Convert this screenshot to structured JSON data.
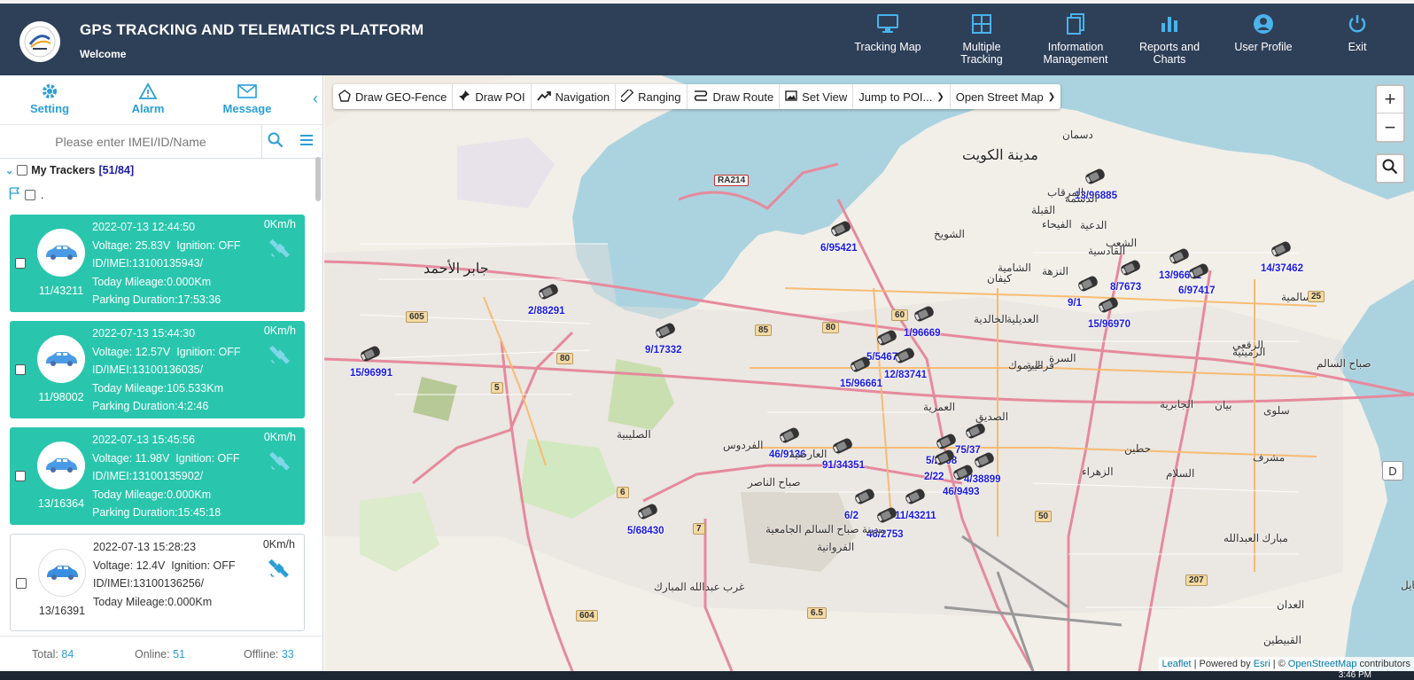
{
  "header": {
    "title": "GPS TRACKING AND TELEMATICS PLATFORM",
    "welcome": "Welcome",
    "nav": [
      {
        "label": "Tracking Map",
        "icon": "monitor-icon"
      },
      {
        "label": "Multiple\nTracking",
        "icon": "grid-icon"
      },
      {
        "label": "Information\nManagement",
        "icon": "documents-icon"
      },
      {
        "label": "Reports and\nCharts",
        "icon": "bar-chart-icon"
      },
      {
        "label": "User Profile",
        "icon": "user-icon"
      },
      {
        "label": "Exit",
        "icon": "power-icon"
      }
    ]
  },
  "sidebar": {
    "tabs": [
      {
        "label": "Setting",
        "icon": "gear-icon"
      },
      {
        "label": "Alarm",
        "icon": "warning-icon"
      },
      {
        "label": "Message",
        "icon": "envelope-icon"
      }
    ],
    "search_placeholder": "Please enter IMEI/ID/Name",
    "tree_label": "My Trackers",
    "tree_count": "[51/84]",
    "flag_label": ".",
    "trackers": [
      {
        "name": "11/43211",
        "time": "2022-07-13 12:44:50",
        "speed": "0Km/h",
        "voltage": "Voltage: 25.83V",
        "ignition": "Ignition: OFF",
        "imei": "ID/IMEI:13100135943/",
        "mileage": "Today Mileage:0.000Km",
        "parking": "Parking Duration:17:53:36",
        "status": "online"
      },
      {
        "name": "11/98002",
        "time": "2022-07-13 15:44:30",
        "speed": "0Km/h",
        "voltage": "Voltage: 12.57V",
        "ignition": "Ignition: OFF",
        "imei": "ID/IMEI:13100136035/",
        "mileage": "Today Mileage:105.533Km",
        "parking": "Parking Duration:4:2:46",
        "status": "online"
      },
      {
        "name": "13/16364",
        "time": "2022-07-13 15:45:56",
        "speed": "0Km/h",
        "voltage": "Voltage: 11.98V",
        "ignition": "Ignition: OFF",
        "imei": "ID/IMEI:13100135902/",
        "mileage": "Today Mileage:0.000Km",
        "parking": "Parking Duration:15:45:18",
        "status": "online"
      },
      {
        "name": "13/16391",
        "time": "2022-07-13 15:28:23",
        "speed": "0Km/h",
        "voltage": "Voltage: 12.4V",
        "ignition": "Ignition: OFF",
        "imei": "ID/IMEI:13100136256/",
        "mileage": "Today Mileage:0.000Km",
        "parking": "",
        "status": "offline"
      }
    ],
    "footer": {
      "total_label": "Total:",
      "total": "84",
      "online_label": "Online:",
      "online": "51",
      "offline_label": "Offline:",
      "offline": "33"
    }
  },
  "map": {
    "toolbar": [
      "Draw GEO-Fence",
      "Draw POI",
      "Navigation",
      "Ranging",
      "Draw Route",
      "Set View",
      "Jump to POI...",
      "Open Street Map"
    ],
    "zoom_in": "+",
    "zoom_out": "−",
    "d_button": "D",
    "attribution": {
      "leaflet": "Leaflet",
      "powered": "| Powered by",
      "esri": "Esri",
      "sep": "| ©",
      "osm": "OpenStreetMap",
      "contributors": "contributors"
    },
    "vehicles": [
      "13/96885",
      "6/95421",
      "2/88291",
      "9/17332",
      "15/96991",
      "13/96631",
      "8/7673",
      "6/97417",
      "14/37462",
      "9/1",
      "15/96970",
      "1/96669",
      "5/5467",
      "12/83741",
      "15/96661",
      "46/9136",
      "91/34351",
      "5/2098",
      "2/22",
      "75/37",
      "4/38899",
      "46/9493",
      "6/2",
      "11/43211",
      "46/2753",
      "5/68430"
    ],
    "places": [
      "مدينة الكويت",
      "جابر الأحمد",
      "الفروانية",
      "العارضية",
      "الصليبية",
      "الفردوس",
      "صباح الناصر",
      "العمرية",
      "السالمية",
      "الجابرية",
      "بيان",
      "سلوى",
      "مشرف",
      "حطين",
      "الزهراء",
      "الصديق",
      "السلام",
      "مبارك العبدالله",
      "صباح السالم",
      "المسايل",
      "العدان",
      "الشويخ",
      "الدسمة",
      "الشعب",
      "الدعية",
      "كيفان",
      "الشامية",
      "اليرموك",
      "قرطبة",
      "السرة",
      "الخالدية",
      "العديلية",
      "القادسية",
      "النزهة",
      "الفيحاء",
      "المرقاب",
      "القبلة",
      "دسمان",
      "الرقعي",
      "غرب عبدالله المبارك",
      "مدينة صباح السالم الجامعية",
      "القبيطين",
      "الرميثية"
    ],
    "road_shields": [
      "RA214",
      "605",
      "80",
      "85",
      "80",
      "60",
      "5",
      "6",
      "7",
      "604",
      "6.5",
      "50",
      "207",
      "25"
    ]
  },
  "taskbar": {
    "clock": "3:46 PM"
  }
}
